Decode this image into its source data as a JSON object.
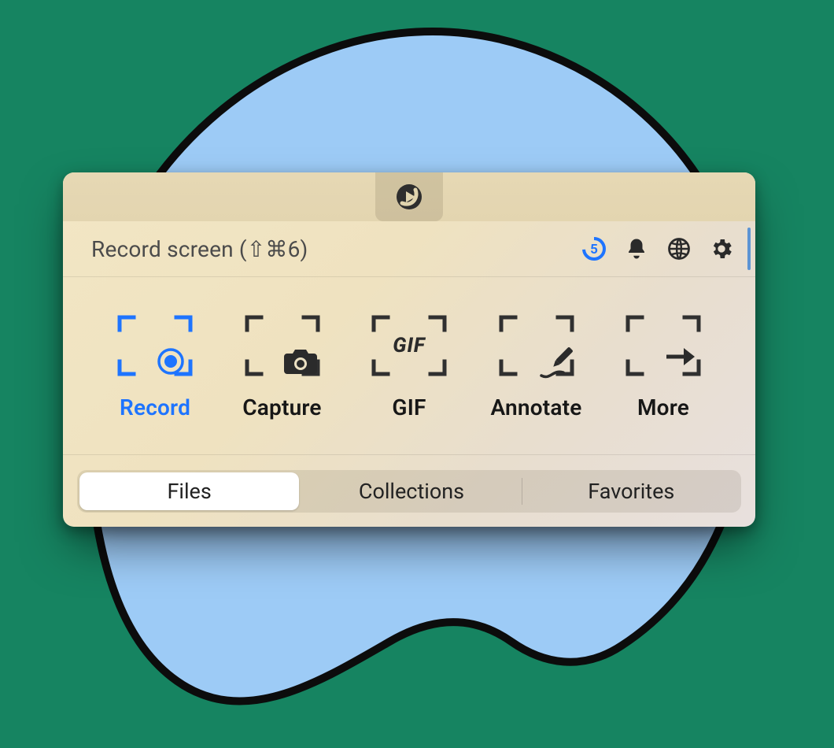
{
  "colors": {
    "accent": "#1e74ff",
    "dark": "#2a2a2a",
    "bg_green": "#168461",
    "blob": "#9dcbf6"
  },
  "header": {
    "title": "Record screen (⇧⌘6)",
    "countdown_value": "5"
  },
  "icons": {
    "menubar": "logo-icon",
    "globe": "globe-icon",
    "bell": "bell-icon",
    "gear": "gear-icon",
    "countdown": "countdown-icon"
  },
  "actions": [
    {
      "id": "record",
      "label": "Record",
      "icon": "record-icon",
      "active": true
    },
    {
      "id": "capture",
      "label": "Capture",
      "icon": "camera-icon",
      "active": false
    },
    {
      "id": "gif",
      "label": "GIF",
      "icon": "gif-icon",
      "active": false
    },
    {
      "id": "annotate",
      "label": "Annotate",
      "icon": "pencil-icon",
      "active": false
    },
    {
      "id": "more",
      "label": "More",
      "icon": "arrow-icon",
      "active": false
    }
  ],
  "tabs": [
    {
      "id": "files",
      "label": "Files",
      "active": true
    },
    {
      "id": "collections",
      "label": "Collections",
      "active": false
    },
    {
      "id": "favorites",
      "label": "Favorites",
      "active": false
    }
  ]
}
